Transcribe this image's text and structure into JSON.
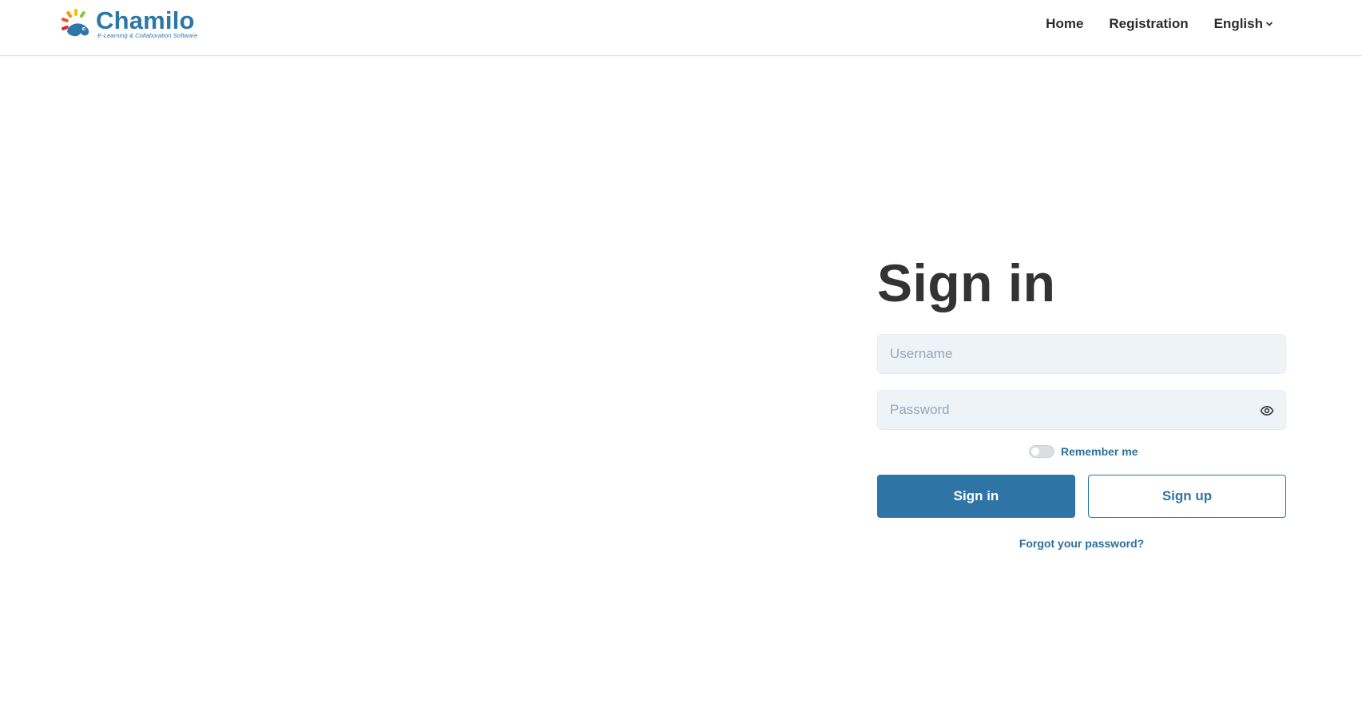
{
  "header": {
    "logo": {
      "name": "Chamilo",
      "tagline": "E-Learning & Collaboration Software"
    },
    "nav": {
      "home": "Home",
      "registration": "Registration",
      "language": "English"
    }
  },
  "login": {
    "title": "Sign in",
    "username_placeholder": "Username",
    "password_placeholder": "Password",
    "remember_label": "Remember me",
    "remember_checked": false,
    "signin_label": "Sign in",
    "signup_label": "Sign up",
    "forgot_label": "Forgot your password?"
  },
  "colors": {
    "brand": "#2e74a4",
    "input_bg": "#eef3f7",
    "title": "#333333"
  },
  "icons": [
    "chamilo-logo-icon",
    "chevron-down-icon",
    "eye-icon"
  ]
}
